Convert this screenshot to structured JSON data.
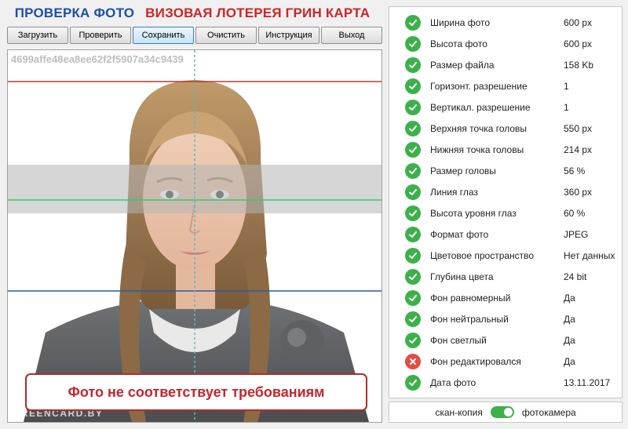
{
  "header": {
    "title_left": "ПРОВЕРКА ФОТО",
    "title_right": "ВИЗОВАЯ ЛОТЕРЕЯ ГРИН КАРТА"
  },
  "toolbar": {
    "buttons": [
      {
        "label": "Загрузить",
        "active": false
      },
      {
        "label": "Проверить",
        "active": false
      },
      {
        "label": "Сохранить",
        "active": true
      },
      {
        "label": "Очистить",
        "active": false
      },
      {
        "label": "Инструкция",
        "active": false
      },
      {
        "label": "Выход",
        "active": false
      }
    ]
  },
  "photo": {
    "hash": "4699affe48ea8ee62f2f5907a34c9439",
    "watermark": "GREENCARD.BY",
    "result_message": "Фото не соответствует требованиям"
  },
  "checks": [
    {
      "label": "Ширина фото",
      "value": "600 px",
      "status": "ok"
    },
    {
      "label": "Высота фото",
      "value": "600 px",
      "status": "ok"
    },
    {
      "label": "Размер файла",
      "value": "158 Kb",
      "status": "ok"
    },
    {
      "label": "Горизонт. разрешение",
      "value": "1",
      "status": "ok"
    },
    {
      "label": "Вертикал. разрешение",
      "value": "1",
      "status": "ok"
    },
    {
      "label": "Верхняя точка головы",
      "value": "550 px",
      "status": "ok"
    },
    {
      "label": "Нижняя точка головы",
      "value": "214 px",
      "status": "ok"
    },
    {
      "label": "Размер головы",
      "value": "56 %",
      "status": "ok"
    },
    {
      "label": "Линия глаз",
      "value": "360 px",
      "status": "ok"
    },
    {
      "label": "Высота уровня глаз",
      "value": "60 %",
      "status": "ok"
    },
    {
      "label": "Формат фото",
      "value": "JPEG",
      "status": "ok"
    },
    {
      "label": "Цветовое пространство",
      "value": "Нет данных",
      "status": "ok"
    },
    {
      "label": "Глубина цвета",
      "value": "24 bit",
      "status": "ok"
    },
    {
      "label": "Фон равномерный",
      "value": "Да",
      "status": "ok"
    },
    {
      "label": "Фон нейтральный",
      "value": "Да",
      "status": "ok"
    },
    {
      "label": "Фон светлый",
      "value": "Да",
      "status": "ok"
    },
    {
      "label": "Фон редактировался",
      "value": "Да",
      "status": "fail"
    },
    {
      "label": "Дата фото",
      "value": "13.11.2017",
      "status": "ok"
    }
  ],
  "source_toggle": {
    "left_label": "скан-копия",
    "right_label": "фотокамера",
    "state": "right"
  },
  "colors": {
    "ok": "#3cb14a",
    "fail": "#e04d43",
    "title_blue": "#1f4fa6",
    "title_red": "#c9262b"
  }
}
